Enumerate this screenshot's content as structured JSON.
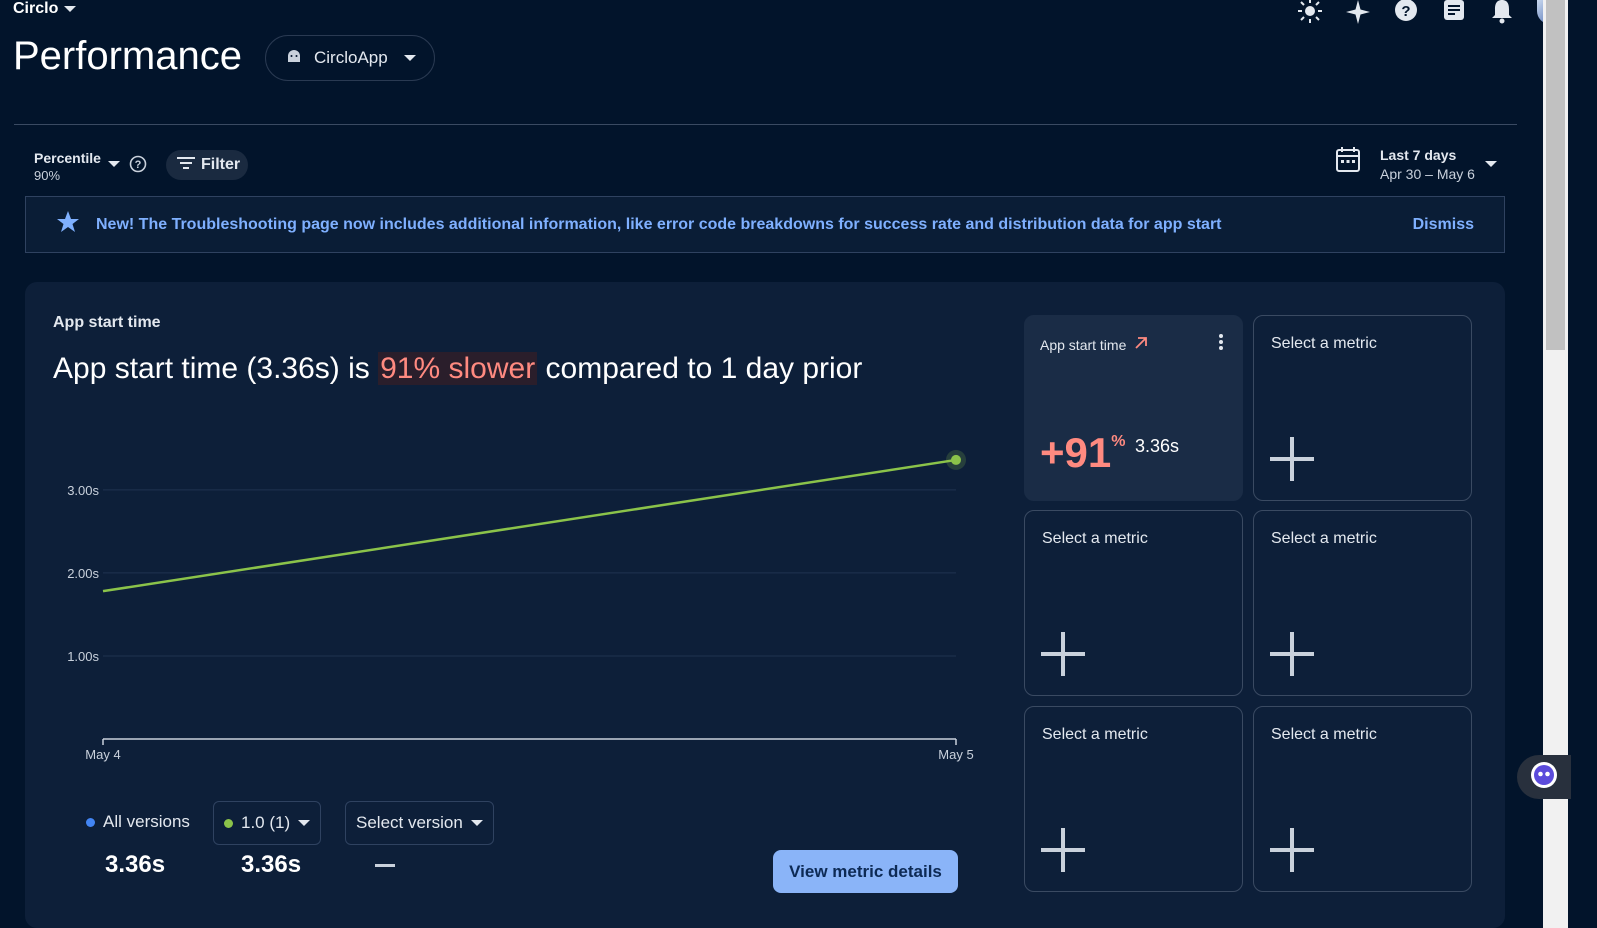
{
  "header": {
    "project_name": "Circlo",
    "page_title": "Performance",
    "app_selector": "CircloApp"
  },
  "filters": {
    "percentile_label": "Percentile",
    "percentile_value": "90%",
    "filter_label": "Filter",
    "date_label": "Last 7 days",
    "date_range": "Apr 30 – May 6"
  },
  "banner": {
    "message": "New! The Troubleshooting page now includes additional information, like error code breakdowns for success rate and distribution data for app start",
    "dismiss_label": "Dismiss"
  },
  "card": {
    "label": "App start time",
    "headline_pre": "App start time (3.36s) is ",
    "headline_highlight": "91% slower",
    "headline_post": " compared to 1 day prior"
  },
  "chart_data": {
    "type": "line",
    "x": [
      "May 4",
      "May 5"
    ],
    "series": [
      {
        "values": [
          1.78,
          3.36
        ],
        "color": "#8bc34a"
      }
    ],
    "y_ticks": [
      "1.00s",
      "2.00s",
      "3.00s"
    ],
    "ylim": [
      0,
      3.6
    ],
    "grid": true
  },
  "versions": {
    "all_label": "All versions",
    "all_value": "3.36s",
    "v1_label": "1.0 (1)",
    "v1_value": "3.36s",
    "select_label": "Select version",
    "select_value": "—",
    "colors": {
      "all": "#4285f4",
      "v1": "#8bc34a"
    }
  },
  "view_details_label": "View metric details",
  "tiles": {
    "active": {
      "title": "App start time",
      "change": "+91",
      "change_unit": "%",
      "value": "3.36s"
    },
    "placeholder_label": "Select a metric"
  }
}
